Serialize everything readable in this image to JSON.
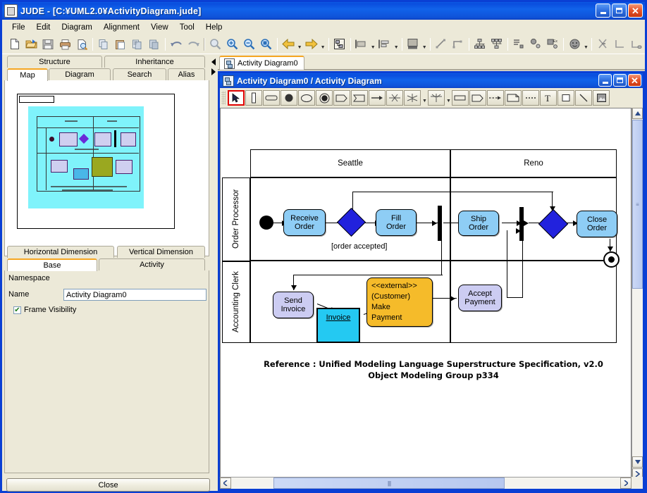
{
  "window": {
    "title": "JUDE - [C:¥UML2.0¥ActivityDiagram.jude]",
    "icon": "jude-app-icon",
    "minimize": "_",
    "maximize": "□",
    "close": "✕"
  },
  "menu": {
    "items": [
      "File",
      "Edit",
      "Diagram",
      "Alignment",
      "View",
      "Tool",
      "Help"
    ]
  },
  "toolbar": {
    "groups": [
      [
        "new-document-icon",
        "open-folder-icon",
        "save-disk-icon",
        "print-icon",
        "print-preview-icon"
      ],
      [
        "copy-icon",
        "paste-icon",
        "copy-page-icon",
        "paste-page-icon"
      ],
      [
        "undo-icon",
        "redo-icon"
      ],
      [
        "zoom-reset-icon",
        "zoom-in-icon",
        "zoom-out-icon",
        "zoom-fit-icon"
      ],
      [
        "back-arrow-icon",
        "forward-arrow-icon"
      ],
      [
        "structure-tree-icon"
      ],
      [
        "align-horizontal-icon",
        "align-vertical-icon"
      ],
      [
        "fill-color-icon"
      ],
      [
        "line-diagonal-icon",
        "line-elbow-icon"
      ],
      [
        "hierarchy-down-icon",
        "hierarchy-up-icon"
      ],
      [
        "list-layout-icon",
        "object-layout-icon",
        "object-ex-layout-icon"
      ],
      [
        "smiley-icon"
      ],
      [
        "cut-scissors-icon",
        "corner-left-icon",
        "corner-right-icon"
      ]
    ]
  },
  "sidebar": {
    "tabs_top": [
      {
        "label": "Structure",
        "selected": false
      },
      {
        "label": "Inheritance",
        "selected": false
      }
    ],
    "tabs_bottom": [
      {
        "label": "Map",
        "selected": true
      },
      {
        "label": "Diagram",
        "selected": false
      },
      {
        "label": "Search",
        "selected": false
      },
      {
        "label": "Alias",
        "selected": false
      }
    ],
    "map": {
      "name": "map-thumbnail"
    },
    "property": {
      "tabs_top": [
        {
          "label": "Horizontal Dimension",
          "selected": false
        },
        {
          "label": "Vertical Dimension",
          "selected": false
        }
      ],
      "tabs_bottom": [
        {
          "label": "Base",
          "selected": true
        },
        {
          "label": "Activity",
          "selected": false
        }
      ],
      "namespace_label": "Namespace",
      "namespace_value": "",
      "name_label": "Name",
      "name_value": "Activity Diagram0",
      "frame_visibility_label": "Frame Visibility",
      "frame_visibility_checked": true,
      "checkmark": "✔"
    },
    "close_button": "Close"
  },
  "document_tab": {
    "label": "Activity Diagram0",
    "icon": "diagram-tab-icon"
  },
  "mdi": {
    "title": "Activity Diagram0 / Activity Diagram",
    "icon": "activity-diagram-icon",
    "minimize": "_",
    "restore": "❐",
    "close": "✕",
    "toolbar": [
      {
        "name": "select-pointer-tool",
        "selected": true
      },
      {
        "name": "partition-vertical-tool",
        "selected": false
      },
      {
        "name": "action-rounded-tool",
        "selected": false
      },
      {
        "name": "initial-node-tool",
        "selected": false
      },
      {
        "name": "ellipse-node-tool",
        "selected": false
      },
      {
        "name": "final-node-tool",
        "selected": false
      },
      {
        "name": "send-signal-tool",
        "selected": false
      },
      {
        "name": "accept-event-tool",
        "selected": false
      },
      {
        "name": "flow-arrow-tool",
        "selected": false
      },
      {
        "name": "fork-node-tool",
        "selected": false
      },
      {
        "name": "join-node-tool",
        "selected": false
      },
      {
        "name": "object-node-tool",
        "selected": false
      },
      {
        "name": "pin-node-tool",
        "selected": false
      },
      {
        "name": "dependency-tool",
        "selected": false
      },
      {
        "name": "note-tool",
        "selected": false
      },
      {
        "name": "note-anchor-tool",
        "selected": false
      },
      {
        "name": "text-tool",
        "selected": false
      },
      {
        "name": "rectangle-tool",
        "selected": false
      },
      {
        "name": "line-tool",
        "selected": false
      },
      {
        "name": "image-tool",
        "selected": false
      }
    ]
  },
  "diagram": {
    "partitions_columns": [
      "Seattle",
      "Reno"
    ],
    "partitions_rows": [
      "Order Processor",
      "Accounting Clerk"
    ],
    "nodes": [
      {
        "id": "initial",
        "type": "initial-node",
        "label": ""
      },
      {
        "id": "receive-order",
        "type": "action",
        "label": [
          "Receive",
          "Order"
        ],
        "color": "#8ecdf5"
      },
      {
        "id": "decision1",
        "type": "decision",
        "label": ""
      },
      {
        "id": "fill-order",
        "type": "action",
        "label": [
          "Fill",
          "Order"
        ],
        "color": "#8ecdf5"
      },
      {
        "id": "fork1",
        "type": "fork-bar",
        "label": ""
      },
      {
        "id": "ship-order",
        "type": "action",
        "label": [
          "Ship",
          "Order"
        ],
        "color": "#8ecdf5"
      },
      {
        "id": "join1",
        "type": "join-bar",
        "label": ""
      },
      {
        "id": "merge1",
        "type": "merge",
        "label": ""
      },
      {
        "id": "close-order",
        "type": "action",
        "label": [
          "Close",
          "Order"
        ],
        "color": "#8ecdf5"
      },
      {
        "id": "final",
        "type": "final-node",
        "label": ""
      },
      {
        "id": "send-invoice",
        "type": "action",
        "label": [
          "Send",
          "Invoice"
        ],
        "color": "#ccccf2"
      },
      {
        "id": "invoice",
        "type": "object-node",
        "label": [
          "Invoice"
        ],
        "color": "#24c9f2"
      },
      {
        "id": "make-payment",
        "type": "action",
        "label": [
          "<<external>>",
          "(Customer)",
          "Make",
          "Payment"
        ],
        "color": "#f5bb2a"
      },
      {
        "id": "accept-payment",
        "type": "action",
        "label": [
          "Accept",
          "Payment"
        ],
        "color": "#ccccf2"
      }
    ],
    "guard": "[order accepted]",
    "reference_line1": "Reference : Unified Modeling Language Superstructure Specification, v2.0",
    "reference_line2": "Object Modeling Group p334"
  },
  "scrollbars": {
    "v_up": "▲",
    "v_down": "▼",
    "v_grip": "≡",
    "h_left": "❮",
    "h_right": "❯",
    "h_grip": "||||",
    "extra_down": "❯"
  },
  "colors": {
    "titlebar_blue": "#0a4ddd",
    "panel_beige": "#ece9d8",
    "action_blue": "#8ecdf5",
    "action_lavender": "#ccccf2",
    "object_cyan": "#24c9f2",
    "external_orange": "#f5bb2a",
    "decision_blue": "#2222dd",
    "selected_tool_red": "#e00000",
    "tab_accent_orange": "#f5a623",
    "map_viewport_cyan": "#7ff3fb"
  }
}
